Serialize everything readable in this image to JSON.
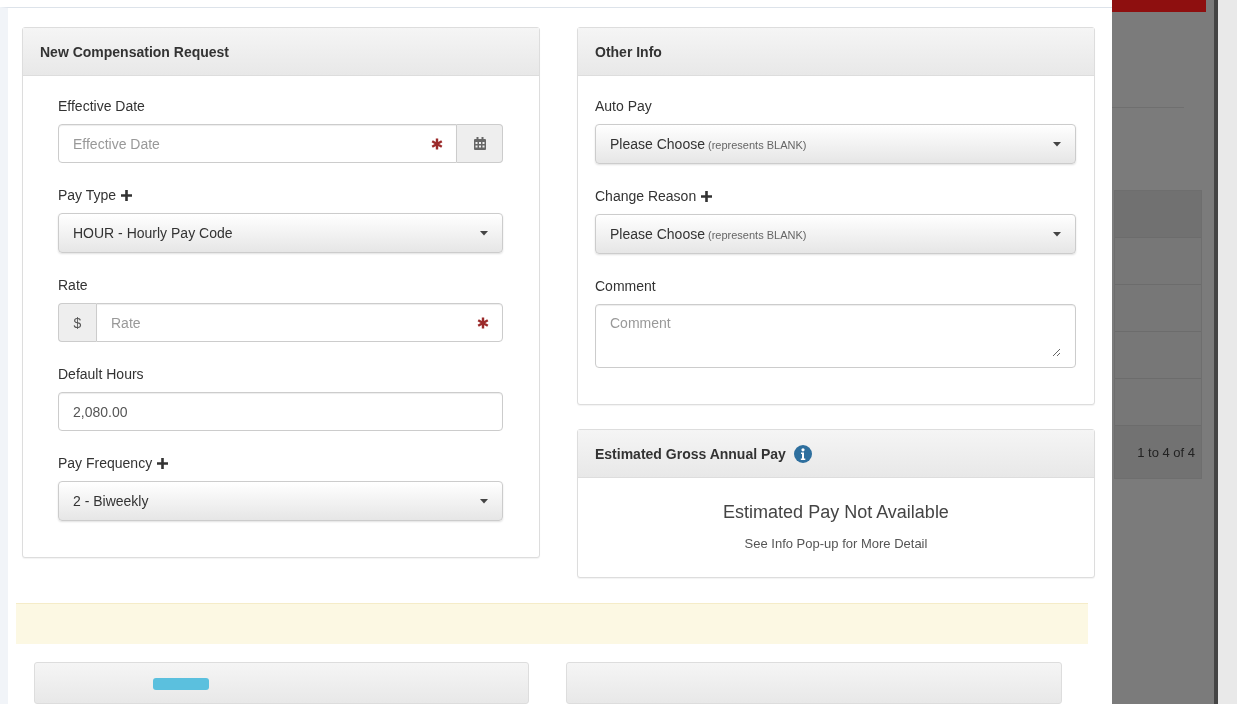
{
  "left_panel": {
    "title": "New Compensation Request",
    "fields": [
      {
        "kind": "date",
        "label": "Effective Date",
        "placeholder": "Effective Date",
        "required": true,
        "addable": false
      },
      {
        "kind": "select",
        "label": "Pay Type",
        "value": "HOUR - Hourly Pay Code",
        "required": false,
        "addable": true
      },
      {
        "kind": "currency",
        "label": "Rate",
        "prefix": "$",
        "placeholder": "Rate",
        "required": true,
        "addable": false
      },
      {
        "kind": "text",
        "label": "Default Hours",
        "value": "2,080.00",
        "required": false,
        "addable": false
      },
      {
        "kind": "select",
        "label": "Pay Frequency",
        "value": "2 - Biweekly",
        "required": false,
        "addable": true
      }
    ]
  },
  "right_panel": {
    "title": "Other Info",
    "fields": [
      {
        "kind": "select",
        "label": "Auto Pay",
        "value": "Please Choose",
        "hint": "(represents BLANK)",
        "required": false,
        "addable": false
      },
      {
        "kind": "select",
        "label": "Change Reason",
        "value": "Please Choose",
        "hint": "(represents BLANK)",
        "required": false,
        "addable": true
      },
      {
        "kind": "textarea",
        "label": "Comment",
        "placeholder": "Comment",
        "required": false,
        "addable": false
      }
    ]
  },
  "estimate_panel": {
    "title": "Estimated Gross Annual Pay",
    "message": "Estimated Pay Not Available",
    "detail": "See Info Pop-up for More Detail"
  },
  "background_page": {
    "pager": "1 to 4 of 4"
  }
}
